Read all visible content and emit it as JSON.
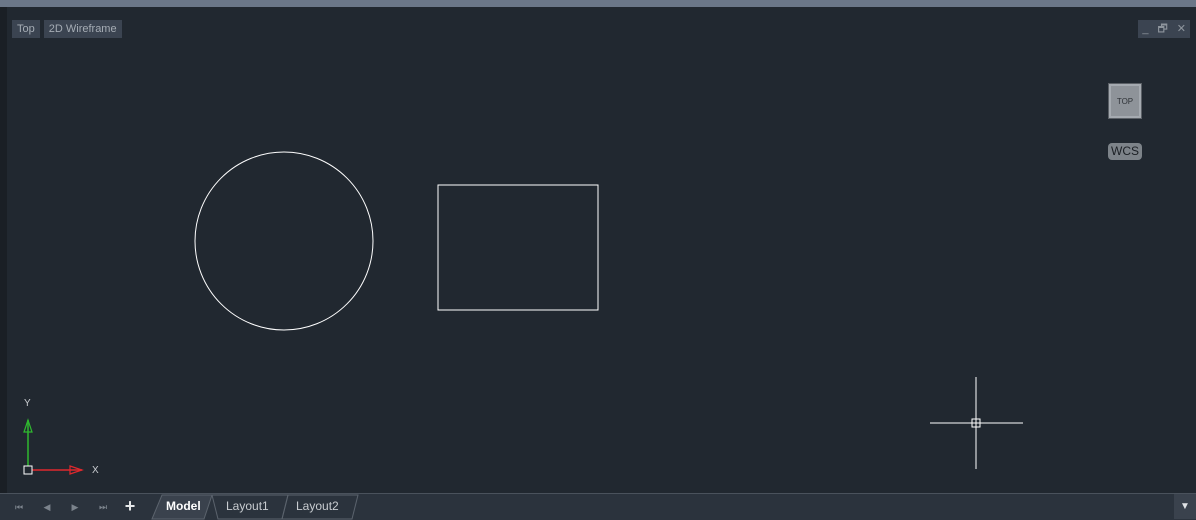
{
  "viewport": {
    "view_label": "Top",
    "style_label": "2D Wireframe",
    "controls": {
      "minimize": "_",
      "restore": "🗗",
      "close": "✕"
    }
  },
  "navigation": {
    "viewcube_label": "TOP",
    "wcs_label": "WCS"
  },
  "ucs": {
    "x_label": "X",
    "y_label": "Y"
  },
  "tabs": {
    "nav": {
      "first": "⏮",
      "prev": "◀",
      "next": "▶",
      "last": "⏭",
      "add": "+"
    },
    "items": [
      {
        "label": "Model",
        "active": true
      },
      {
        "label": "Layout1",
        "active": false
      },
      {
        "label": "Layout2",
        "active": false
      }
    ],
    "scroll": "▼"
  },
  "colors": {
    "background": "#212830",
    "geometry": "#ffffff",
    "x_axis": "#e0282d",
    "y_axis": "#2fb82f"
  },
  "icons": [
    "first-icon",
    "prev-icon",
    "next-icon",
    "last-icon",
    "add-icon",
    "dropdown-icon",
    "crosshair-cursor-icon"
  ]
}
